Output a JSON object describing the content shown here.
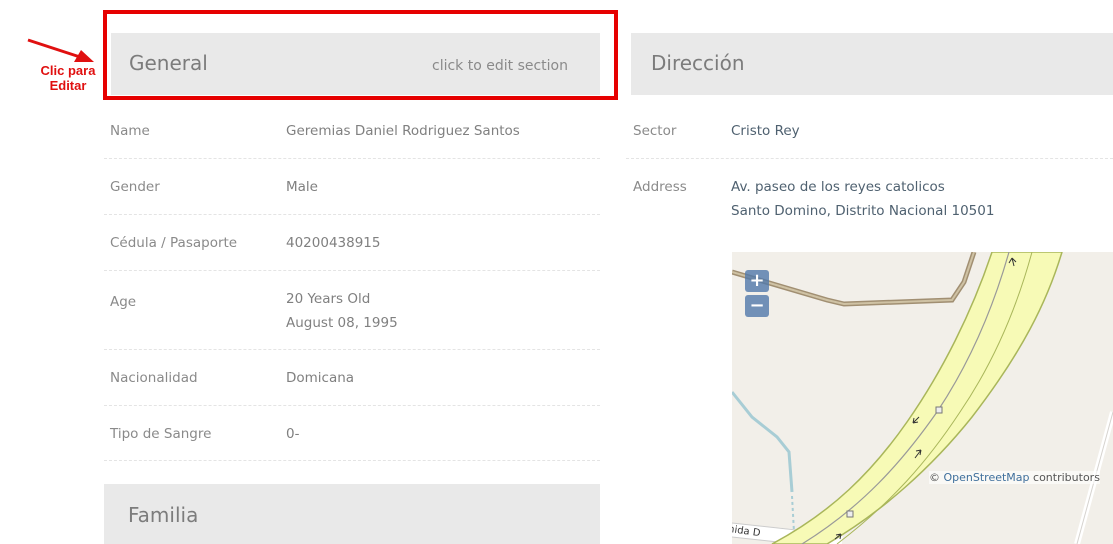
{
  "annotation": {
    "text_line1": "Clic para",
    "text_line2": "Editar",
    "color": "#e01010"
  },
  "general": {
    "title": "General",
    "edit_hint": "click to edit section",
    "rows": [
      {
        "label": "Name",
        "value": "Geremias Daniel Rodriguez Santos"
      },
      {
        "label": "Gender",
        "value": "Male"
      },
      {
        "label": "Cédula / Pasaporte",
        "value": "40200438915"
      },
      {
        "label": "Age",
        "value": "20 Years Old",
        "value2": "August 08, 1995"
      },
      {
        "label": "Nacionalidad",
        "value": "Domicana"
      },
      {
        "label": "Tipo de Sangre",
        "value": "0-"
      }
    ]
  },
  "direccion": {
    "title": "Dirección",
    "rows": [
      {
        "label": "Sector",
        "value": "Cristo Rey"
      },
      {
        "label": "Address",
        "value": "Av. paseo de los reyes catolicos",
        "value2": "Santo Domino, Distrito Nacional 10501"
      }
    ]
  },
  "map": {
    "zoom_in": "+",
    "zoom_out": "−",
    "attribution_symbol": "©",
    "attribution_link": "OpenStreetMap",
    "attribution_suffix": "contributors",
    "street_label": "nida D"
  },
  "familia": {
    "title": "Familia"
  }
}
